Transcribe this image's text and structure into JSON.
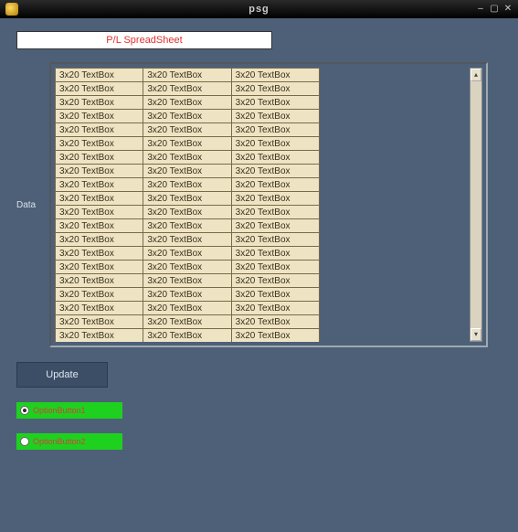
{
  "window": {
    "title": "psg"
  },
  "header": {
    "value": "P/L SpreadSheet"
  },
  "data_section": {
    "label": "Data",
    "cell_value": "3x20 TextBox",
    "rows": 20,
    "cols": 3
  },
  "buttons": {
    "update": "Update"
  },
  "radios": {
    "opt1": {
      "label": "OptionButton1",
      "selected": true
    },
    "opt2": {
      "label": "OptionButton2",
      "selected": false
    }
  },
  "colors": {
    "app_bg": "#4d6078",
    "cell_bg": "#eee4c3",
    "radio_bg": "#1fd11f",
    "header_text": "#e03030"
  }
}
